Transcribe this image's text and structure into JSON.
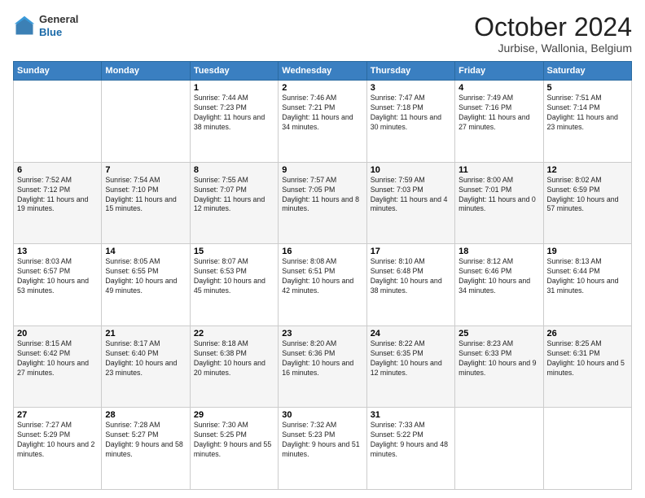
{
  "logo": {
    "general": "General",
    "blue": "Blue"
  },
  "header": {
    "month": "October 2024",
    "location": "Jurbise, Wallonia, Belgium"
  },
  "weekdays": [
    "Sunday",
    "Monday",
    "Tuesday",
    "Wednesday",
    "Thursday",
    "Friday",
    "Saturday"
  ],
  "weeks": [
    [
      {
        "day": "",
        "sunrise": "",
        "sunset": "",
        "daylight": ""
      },
      {
        "day": "",
        "sunrise": "",
        "sunset": "",
        "daylight": ""
      },
      {
        "day": "1",
        "sunrise": "Sunrise: 7:44 AM",
        "sunset": "Sunset: 7:23 PM",
        "daylight": "Daylight: 11 hours and 38 minutes."
      },
      {
        "day": "2",
        "sunrise": "Sunrise: 7:46 AM",
        "sunset": "Sunset: 7:21 PM",
        "daylight": "Daylight: 11 hours and 34 minutes."
      },
      {
        "day": "3",
        "sunrise": "Sunrise: 7:47 AM",
        "sunset": "Sunset: 7:18 PM",
        "daylight": "Daylight: 11 hours and 30 minutes."
      },
      {
        "day": "4",
        "sunrise": "Sunrise: 7:49 AM",
        "sunset": "Sunset: 7:16 PM",
        "daylight": "Daylight: 11 hours and 27 minutes."
      },
      {
        "day": "5",
        "sunrise": "Sunrise: 7:51 AM",
        "sunset": "Sunset: 7:14 PM",
        "daylight": "Daylight: 11 hours and 23 minutes."
      }
    ],
    [
      {
        "day": "6",
        "sunrise": "Sunrise: 7:52 AM",
        "sunset": "Sunset: 7:12 PM",
        "daylight": "Daylight: 11 hours and 19 minutes."
      },
      {
        "day": "7",
        "sunrise": "Sunrise: 7:54 AM",
        "sunset": "Sunset: 7:10 PM",
        "daylight": "Daylight: 11 hours and 15 minutes."
      },
      {
        "day": "8",
        "sunrise": "Sunrise: 7:55 AM",
        "sunset": "Sunset: 7:07 PM",
        "daylight": "Daylight: 11 hours and 12 minutes."
      },
      {
        "day": "9",
        "sunrise": "Sunrise: 7:57 AM",
        "sunset": "Sunset: 7:05 PM",
        "daylight": "Daylight: 11 hours and 8 minutes."
      },
      {
        "day": "10",
        "sunrise": "Sunrise: 7:59 AM",
        "sunset": "Sunset: 7:03 PM",
        "daylight": "Daylight: 11 hours and 4 minutes."
      },
      {
        "day": "11",
        "sunrise": "Sunrise: 8:00 AM",
        "sunset": "Sunset: 7:01 PM",
        "daylight": "Daylight: 11 hours and 0 minutes."
      },
      {
        "day": "12",
        "sunrise": "Sunrise: 8:02 AM",
        "sunset": "Sunset: 6:59 PM",
        "daylight": "Daylight: 10 hours and 57 minutes."
      }
    ],
    [
      {
        "day": "13",
        "sunrise": "Sunrise: 8:03 AM",
        "sunset": "Sunset: 6:57 PM",
        "daylight": "Daylight: 10 hours and 53 minutes."
      },
      {
        "day": "14",
        "sunrise": "Sunrise: 8:05 AM",
        "sunset": "Sunset: 6:55 PM",
        "daylight": "Daylight: 10 hours and 49 minutes."
      },
      {
        "day": "15",
        "sunrise": "Sunrise: 8:07 AM",
        "sunset": "Sunset: 6:53 PM",
        "daylight": "Daylight: 10 hours and 45 minutes."
      },
      {
        "day": "16",
        "sunrise": "Sunrise: 8:08 AM",
        "sunset": "Sunset: 6:51 PM",
        "daylight": "Daylight: 10 hours and 42 minutes."
      },
      {
        "day": "17",
        "sunrise": "Sunrise: 8:10 AM",
        "sunset": "Sunset: 6:48 PM",
        "daylight": "Daylight: 10 hours and 38 minutes."
      },
      {
        "day": "18",
        "sunrise": "Sunrise: 8:12 AM",
        "sunset": "Sunset: 6:46 PM",
        "daylight": "Daylight: 10 hours and 34 minutes."
      },
      {
        "day": "19",
        "sunrise": "Sunrise: 8:13 AM",
        "sunset": "Sunset: 6:44 PM",
        "daylight": "Daylight: 10 hours and 31 minutes."
      }
    ],
    [
      {
        "day": "20",
        "sunrise": "Sunrise: 8:15 AM",
        "sunset": "Sunset: 6:42 PM",
        "daylight": "Daylight: 10 hours and 27 minutes."
      },
      {
        "day": "21",
        "sunrise": "Sunrise: 8:17 AM",
        "sunset": "Sunset: 6:40 PM",
        "daylight": "Daylight: 10 hours and 23 minutes."
      },
      {
        "day": "22",
        "sunrise": "Sunrise: 8:18 AM",
        "sunset": "Sunset: 6:38 PM",
        "daylight": "Daylight: 10 hours and 20 minutes."
      },
      {
        "day": "23",
        "sunrise": "Sunrise: 8:20 AM",
        "sunset": "Sunset: 6:36 PM",
        "daylight": "Daylight: 10 hours and 16 minutes."
      },
      {
        "day": "24",
        "sunrise": "Sunrise: 8:22 AM",
        "sunset": "Sunset: 6:35 PM",
        "daylight": "Daylight: 10 hours and 12 minutes."
      },
      {
        "day": "25",
        "sunrise": "Sunrise: 8:23 AM",
        "sunset": "Sunset: 6:33 PM",
        "daylight": "Daylight: 10 hours and 9 minutes."
      },
      {
        "day": "26",
        "sunrise": "Sunrise: 8:25 AM",
        "sunset": "Sunset: 6:31 PM",
        "daylight": "Daylight: 10 hours and 5 minutes."
      }
    ],
    [
      {
        "day": "27",
        "sunrise": "Sunrise: 7:27 AM",
        "sunset": "Sunset: 5:29 PM",
        "daylight": "Daylight: 10 hours and 2 minutes."
      },
      {
        "day": "28",
        "sunrise": "Sunrise: 7:28 AM",
        "sunset": "Sunset: 5:27 PM",
        "daylight": "Daylight: 9 hours and 58 minutes."
      },
      {
        "day": "29",
        "sunrise": "Sunrise: 7:30 AM",
        "sunset": "Sunset: 5:25 PM",
        "daylight": "Daylight: 9 hours and 55 minutes."
      },
      {
        "day": "30",
        "sunrise": "Sunrise: 7:32 AM",
        "sunset": "Sunset: 5:23 PM",
        "daylight": "Daylight: 9 hours and 51 minutes."
      },
      {
        "day": "31",
        "sunrise": "Sunrise: 7:33 AM",
        "sunset": "Sunset: 5:22 PM",
        "daylight": "Daylight: 9 hours and 48 minutes."
      },
      {
        "day": "",
        "sunrise": "",
        "sunset": "",
        "daylight": ""
      },
      {
        "day": "",
        "sunrise": "",
        "sunset": "",
        "daylight": ""
      }
    ]
  ]
}
